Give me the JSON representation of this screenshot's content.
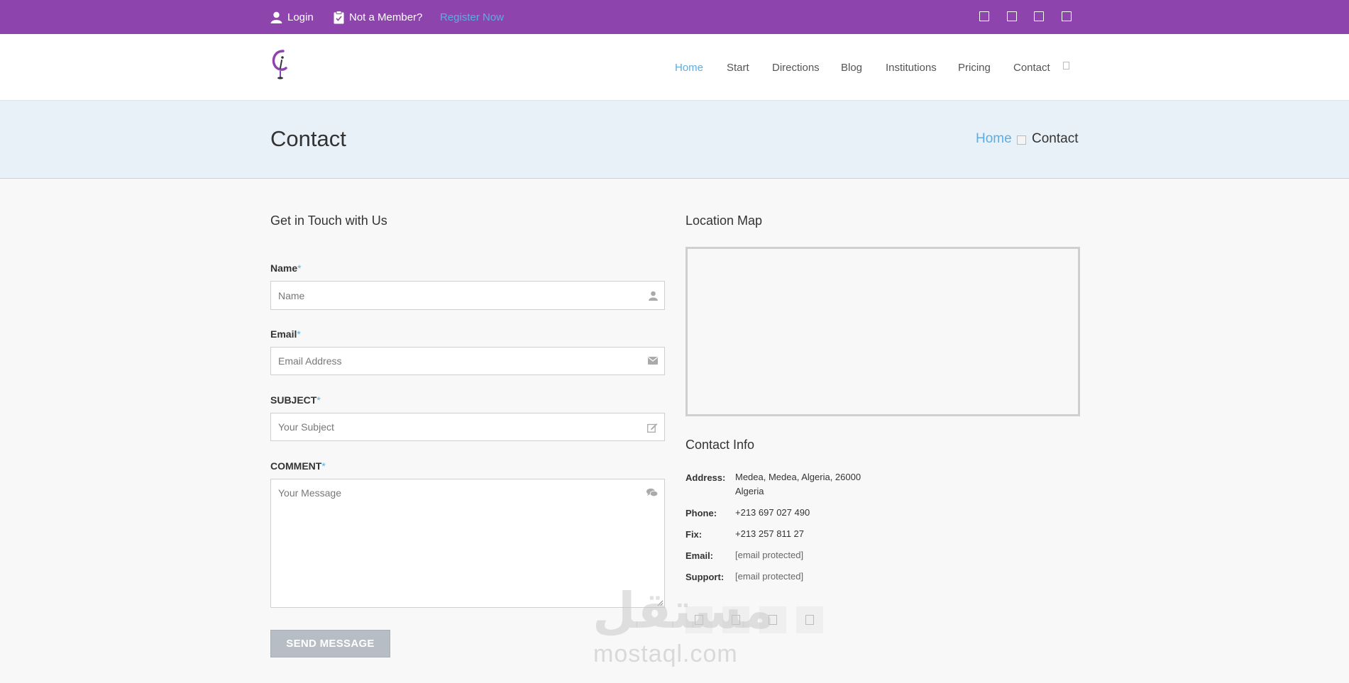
{
  "topbar": {
    "login_label": "Login",
    "member_label": "Not a Member?",
    "register_label": "Register Now"
  },
  "nav": {
    "items": [
      "Home",
      "Start",
      "Directions",
      "Blog",
      "Institutions",
      "Pricing",
      "Contact"
    ],
    "active": "Home"
  },
  "page": {
    "title": "Contact",
    "breadcrumb": [
      "Home",
      "Contact"
    ]
  },
  "form": {
    "title": "Get in Touch with Us",
    "required_mark": "*",
    "name_label": "Name",
    "name_placeholder": "Name",
    "email_label": "Email",
    "email_placeholder": "Email Address",
    "subject_label": "SUBJECT",
    "subject_placeholder": "Your Subject",
    "comment_label": "COMMENT",
    "comment_placeholder": "Your Message",
    "submit_label": "SEND MESSAGE"
  },
  "map": {
    "title": "Location Map"
  },
  "contact_info": {
    "title": "Contact Info",
    "rows": [
      {
        "label": "Address:",
        "value": "Medea, Medea, Algeria, 26000",
        "value2": "Algeria"
      },
      {
        "label": "Phone:",
        "value": "+213 697 027 490"
      },
      {
        "label": "Fix:",
        "value": "+213 257 811 27"
      },
      {
        "label": "Email:",
        "value": "[email protected]"
      },
      {
        "label": "Support:",
        "value": "[email protected]"
      }
    ]
  },
  "watermark": {
    "arabic": "مستقل",
    "latin": "mostaql.com"
  },
  "colors": {
    "topbar": "#8e44ad",
    "accent": "#5dade2",
    "title_band": "#e8f1f8",
    "button": "#b6bdc4"
  }
}
